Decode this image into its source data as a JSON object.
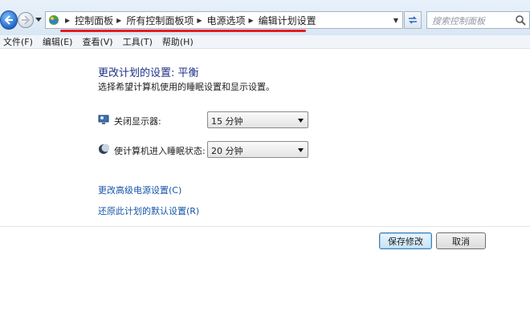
{
  "address_bar": {
    "breadcrumbs": [
      {
        "label": "控制面板"
      },
      {
        "label": "所有控制面板项"
      },
      {
        "label": "电源选项"
      },
      {
        "label": "编辑计划设置"
      }
    ],
    "search_placeholder": "搜索控制面板"
  },
  "menu": {
    "items": [
      {
        "label": "文件(F)"
      },
      {
        "label": "编辑(E)"
      },
      {
        "label": "查看(V)"
      },
      {
        "label": "工具(T)"
      },
      {
        "label": "帮助(H)"
      }
    ]
  },
  "content": {
    "title": "更改计划的设置: 平衡",
    "subtitle": "选择希望计算机使用的睡眠设置和显示设置。",
    "settings": [
      {
        "label": "关闭显示器:",
        "value": "15 分钟",
        "icon": "monitor-icon"
      },
      {
        "label": "使计算机进入睡眠状态:",
        "value": "20 分钟",
        "icon": "moon-icon"
      }
    ],
    "links": {
      "advanced": "更改高级电源设置(C)",
      "restore": "还原此计划的默认设置(R)"
    }
  },
  "buttons": {
    "save": "保存修改",
    "cancel": "取消"
  },
  "colors": {
    "accent_title": "#1e3287",
    "link": "#1555a8",
    "annotation_underline": "#e31b23"
  }
}
